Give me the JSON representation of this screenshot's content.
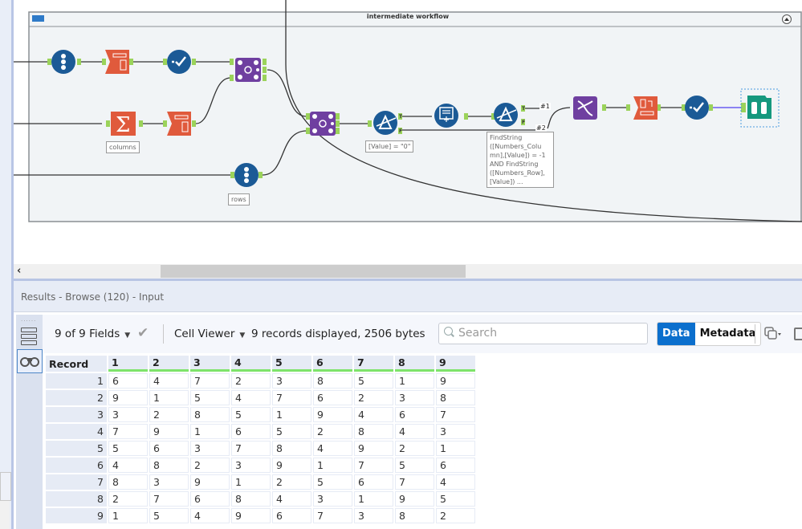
{
  "workflow": {
    "container_title": "intermediate workflow",
    "annotations": {
      "columns": "columns",
      "rows": "rows",
      "filter1": "[Value] = \"0\"",
      "filter2": "FindString ([Numbers_Column],[Value]) = -1 AND FindString ([Numbers_Row], [Value]) ...",
      "filter2_lines": [
        "FindString",
        "([Numbers_Colu",
        "mn],[Value]) = -1",
        "AND FindString",
        "([Numbers_Row],",
        "[Value]) ..."
      ]
    },
    "connection_labels": [
      "#1",
      "#2"
    ],
    "tools": [
      {
        "name": "record-id-tool",
        "icon": "record-id-icon",
        "color": "#1b5a96"
      },
      {
        "name": "text-to-columns-tool",
        "icon": "text-to-columns-icon",
        "color": "#e05a3c"
      },
      {
        "name": "select-tool",
        "icon": "select-icon",
        "color": "#1b5a96"
      },
      {
        "name": "join-tool",
        "icon": "join-icon",
        "color": "#6f3fa0"
      },
      {
        "name": "summarize-tool",
        "icon": "summarize-icon",
        "color": "#e05a3c"
      },
      {
        "name": "text-to-columns-tool-2",
        "icon": "text-to-columns-icon",
        "color": "#e05a3c"
      },
      {
        "name": "record-id-tool-2",
        "icon": "record-id-icon",
        "color": "#1b5a96"
      },
      {
        "name": "join-tool-2",
        "icon": "join-icon",
        "color": "#6f3fa0"
      },
      {
        "name": "filter-tool",
        "icon": "filter-icon",
        "color": "#1b5a96"
      },
      {
        "name": "append-fields-tool",
        "icon": "append-icon",
        "color": "#1b5a96"
      },
      {
        "name": "filter-tool-2",
        "icon": "filter-icon",
        "color": "#1b5a96"
      },
      {
        "name": "union-tool",
        "icon": "dna-icon",
        "color": "#6f3fa0"
      },
      {
        "name": "crosstab-tool",
        "icon": "crosstab-icon",
        "color": "#e05a3c"
      },
      {
        "name": "select-tool-2",
        "icon": "select-icon",
        "color": "#1b5a96"
      },
      {
        "name": "browse-tool",
        "icon": "binoculars-icon",
        "color": "#15987e"
      }
    ]
  },
  "results": {
    "title": "Results - Browse (120) - Input",
    "fields_selector": "9 of 9 Fields",
    "viewer_selector": "Cell Viewer",
    "status": "9 records displayed, 2506 bytes",
    "search_placeholder": "Search",
    "tabs": {
      "data": "Data",
      "metadata": "Metadata"
    },
    "active_tab": "Data",
    "accent_color": "#0b6fcd"
  },
  "table": {
    "columns": [
      "Record",
      "1",
      "2",
      "3",
      "4",
      "5",
      "6",
      "7",
      "8",
      "9"
    ],
    "rows": [
      [
        "1",
        "6",
        "4",
        "7",
        "2",
        "3",
        "8",
        "5",
        "1",
        "9"
      ],
      [
        "2",
        "9",
        "1",
        "5",
        "4",
        "7",
        "6",
        "2",
        "3",
        "8"
      ],
      [
        "3",
        "3",
        "2",
        "8",
        "5",
        "1",
        "9",
        "4",
        "6",
        "7"
      ],
      [
        "4",
        "7",
        "9",
        "1",
        "6",
        "5",
        "2",
        "8",
        "4",
        "3"
      ],
      [
        "5",
        "5",
        "6",
        "3",
        "7",
        "8",
        "4",
        "9",
        "2",
        "1"
      ],
      [
        "6",
        "4",
        "8",
        "2",
        "3",
        "9",
        "1",
        "7",
        "5",
        "6"
      ],
      [
        "7",
        "8",
        "3",
        "9",
        "1",
        "2",
        "5",
        "6",
        "7",
        "4"
      ],
      [
        "8",
        "2",
        "7",
        "6",
        "8",
        "4",
        "3",
        "1",
        "9",
        "5"
      ],
      [
        "9",
        "1",
        "5",
        "4",
        "9",
        "6",
        "7",
        "3",
        "8",
        "2"
      ]
    ]
  }
}
